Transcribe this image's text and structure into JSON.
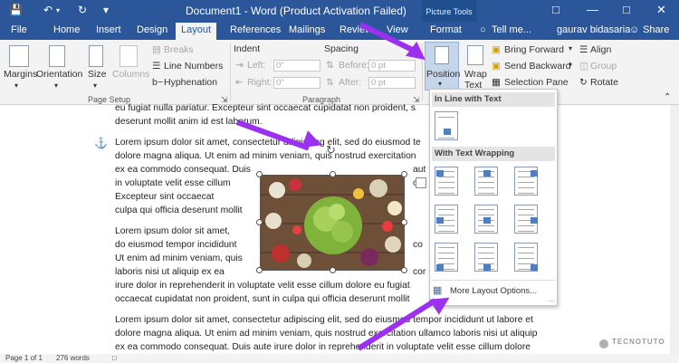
{
  "title": "Document1 - Word (Product Activation Failed)",
  "picture_tools": "Picture Tools",
  "tabs": [
    "File",
    "Home",
    "Insert",
    "Design",
    "Layout",
    "References",
    "Mailings",
    "Review",
    "View",
    "Format"
  ],
  "tell_me": "Tell me...",
  "user": "gaurav bidasaria",
  "share": "Share",
  "ribbon": {
    "margins": "Margins",
    "orientation": "Orientation",
    "size": "Size",
    "columns": "Columns",
    "breaks": "Breaks",
    "line_numbers": "Line Numbers",
    "hyphenation": "Hyphenation",
    "page_setup": "Page Setup",
    "indent": "Indent",
    "left": "Left:",
    "right": "Right:",
    "left_val": "0\"",
    "right_val": "0\"",
    "spacing": "Spacing",
    "before": "Before:",
    "after": "After:",
    "before_val": "0 pt",
    "after_val": "0 pt",
    "paragraph": "Paragraph",
    "position": "Position",
    "wrap_text_1": "Wrap",
    "wrap_text_2": "Text",
    "bring_forward": "Bring Forward",
    "send_backward": "Send Backward",
    "selection_pane": "Selection Pane",
    "align": "Align",
    "group": "Group",
    "rotate": "Rotate"
  },
  "document_lines": [
    "eu fugiat nulla pariatur. Excepteur sint occaecat cupidatat non proident, s",
    "deserunt mollit anim id est laborum.",
    "Lorem ipsum dolor sit amet, consectetur adipiscing elit, sed do eiusmod te",
    "dolore magna aliqua. Ut enim ad minim veniam, quis nostrud exercitation",
    "ex ea commodo consequat. Duis",
    "in voluptate velit esse cillum",
    "Excepteur sint occaecat",
    "culpa qui officia deserunt mollit",
    "Lorem ipsum dolor sit amet,",
    "do eiusmod tempor incididunt",
    "Ut enim ad minim veniam, quis",
    "laboris nisi ut aliquip ex ea",
    "irure dolor in reprehenderit in voluptate velit esse cillum dolore eu fugiat",
    "occaecat cupidatat non proident, sunt in culpa qui officia deserunt mollit",
    "Lorem ipsum dolor sit amet, consectetur adipiscing elit, sed do eiusmod tempor incididunt ut labore et",
    "dolore magna aliqua. Ut enim ad minim veniam, quis nostrud exercitation ullamco laboris nisi ut aliquip",
    "ex ea commodo consequat. Duis aute irure dolor in reprehenderit in voluptate velit esse cillum dolore"
  ],
  "right_fragments": [
    "aut",
    "o",
    "co",
    "cor"
  ],
  "position_menu": {
    "inline_header": "In Line with Text",
    "wrapping_header": "With Text Wrapping",
    "more_options": "More Layout Options..."
  },
  "status": {
    "page": "Page 1 of 1",
    "words": "276 words"
  },
  "watermark": "TECNOTUTO",
  "colors": {
    "brand": "#2b579a",
    "arrow": "#9b30f0"
  }
}
